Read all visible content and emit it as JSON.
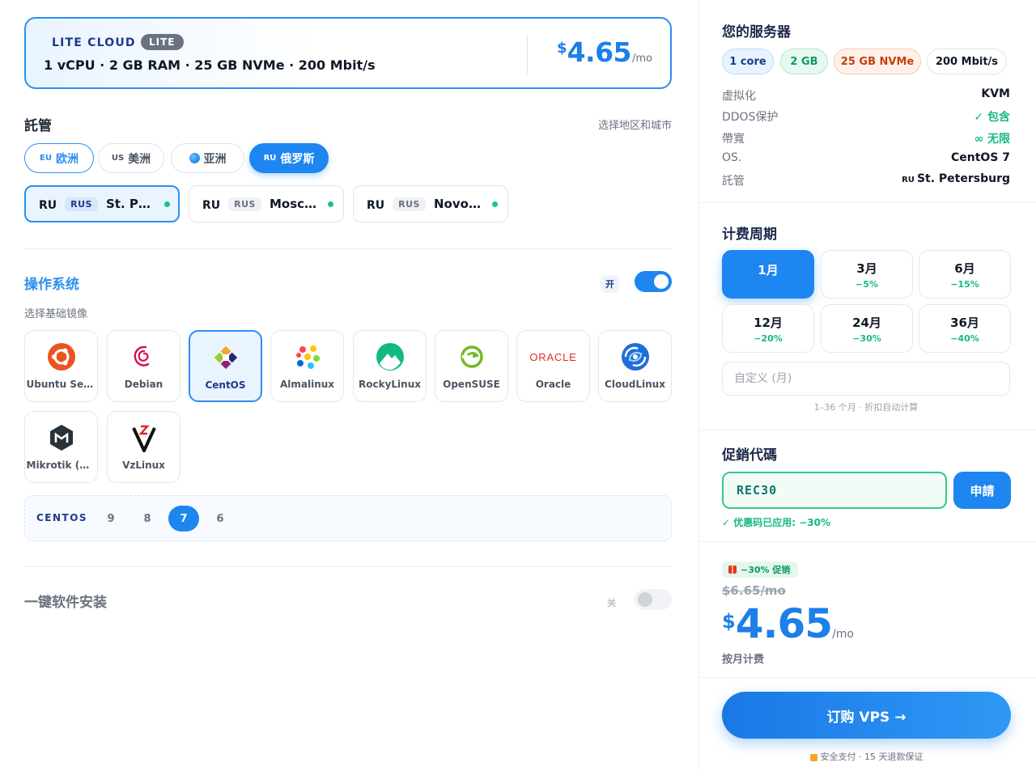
{
  "plan": {
    "name": "LITE CLOUD",
    "tag": "LITE",
    "specs": "1 vCPU · 2 GB RAM · 25 GB NVMe · 200 Mbit/s",
    "price_currency": "$",
    "price_amount": "4.65",
    "price_period": "/mo"
  },
  "hosting": {
    "title": "託管",
    "hint": "选择地区和城市",
    "regions": [
      {
        "code": "EU",
        "label": "欧洲"
      },
      {
        "code": "US",
        "label": "美洲"
      },
      {
        "code": "",
        "label": "亚洲"
      },
      {
        "code": "RU",
        "label": "俄罗斯"
      }
    ],
    "selected_region": "俄罗斯",
    "cities": [
      {
        "cc": "RU",
        "badge": "RUS",
        "name": "St. Pet..."
      },
      {
        "cc": "RU",
        "badge": "RUS",
        "name": "Moscow"
      },
      {
        "cc": "RU",
        "badge": "RUS",
        "name": "Novosi..."
      }
    ]
  },
  "os": {
    "title": "操作系统",
    "toggle_label": "开",
    "toggle_on": true,
    "subtitle": "选择基础镜像",
    "items": [
      {
        "name": "Ubuntu Ser...",
        "icon": "ubuntu-icon"
      },
      {
        "name": "Debian",
        "icon": "debian-icon"
      },
      {
        "name": "CentOS",
        "icon": "centos-icon"
      },
      {
        "name": "Almalinux",
        "icon": "almalinux-icon"
      },
      {
        "name": "RockyLinux",
        "icon": "rockylinux-icon"
      },
      {
        "name": "OpenSUSE",
        "icon": "opensuse-icon"
      },
      {
        "name": "Oracle",
        "icon": "oracle-icon"
      },
      {
        "name": "CloudLinux",
        "icon": "cloudlinux-icon"
      },
      {
        "name": "Mikrotik (Ro...",
        "icon": "mikrotik-icon"
      },
      {
        "name": "VzLinux",
        "icon": "vzlinux-icon"
      }
    ],
    "selected": "CentOS",
    "oracle_logo_text": "ORACLE",
    "version_label": "CENTOS",
    "versions": [
      "9",
      "8",
      "7",
      "6"
    ],
    "selected_version": "7"
  },
  "software": {
    "title": "一键软件安装",
    "toggle_label": "关",
    "toggle_on": false
  },
  "summary": {
    "title": "您的服务器",
    "chips": [
      "1 core",
      "2 GB",
      "25 GB NVMe",
      "200 Mbit/s"
    ],
    "rows": [
      {
        "key": "虚拟化",
        "value": "KVM"
      },
      {
        "key": "DDOS保护",
        "value": "✓ 包含"
      },
      {
        "key": "帶寬",
        "value": "∞ 无限"
      },
      {
        "key": "OS.",
        "value": "CentOS 7"
      },
      {
        "key": "託管",
        "prefix": "RU",
        "value": "St. Petersburg"
      }
    ]
  },
  "billing": {
    "title": "计费周期",
    "periods": [
      {
        "label": "1月",
        "discount": ""
      },
      {
        "label": "3月",
        "discount": "−5%"
      },
      {
        "label": "6月",
        "discount": "−15%"
      },
      {
        "label": "12月",
        "discount": "−20%"
      },
      {
        "label": "24月",
        "discount": "−30%"
      },
      {
        "label": "36月",
        "discount": "−40%"
      }
    ],
    "selected": "1月",
    "custom_placeholder": "自定义 (月)",
    "custom_hint": "1–36 个月 · 折扣自动计算"
  },
  "promo": {
    "title": "促銷代碼",
    "code": "REC30",
    "apply_label": "申請",
    "status": "✓ 优惠码已应用: −30%"
  },
  "total": {
    "badge": "−30% 促销",
    "old_price": "$6.65/mo",
    "currency": "$",
    "amount": "4.65",
    "period": "/mo",
    "note": "按月计费"
  },
  "order": {
    "button_label": "订购 VPS →",
    "secure_note": "安全支付 · 15 天退款保证"
  },
  "colors": {
    "accent": "#1d86f0",
    "success": "#16b981"
  }
}
